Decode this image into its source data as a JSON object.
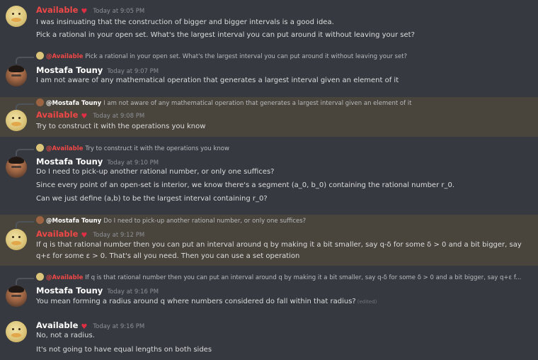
{
  "colors": {
    "background": "#36393f",
    "highlight": "#49443c",
    "available_name": "#f04747",
    "text": "#dcddde",
    "timestamp": "#8e9297"
  },
  "messages": [
    {
      "author": "Available",
      "timestamp": "Today at 9:05 PM",
      "lines": [
        "I was insinuating that the construction of bigger and bigger intervals is a good idea.",
        "Pick a rational in your open set. What's the largest interval you can put around it without leaving your set?"
      ]
    },
    {
      "reply": {
        "author": "@Available",
        "text": "Pick a rational in your open set. What's the largest interval you can put around it without leaving your set?"
      },
      "author": "Mostafa Touny",
      "timestamp": "Today at 9:07 PM",
      "lines": [
        "I am not aware of any mathematical operation that generates a largest interval given an element of it"
      ]
    },
    {
      "reply": {
        "author": "@Mostafa Touny",
        "text": "I am not aware of any mathematical operation that generates a largest interval given an element of it"
      },
      "author": "Available",
      "timestamp": "Today at 9:08 PM",
      "lines": [
        "Try to construct it with the operations you know"
      ]
    },
    {
      "reply": {
        "author": "@Available",
        "text": "Try to construct it with the operations you know"
      },
      "author": "Mostafa Touny",
      "timestamp": "Today at 9:10 PM",
      "lines": [
        "Do I need to pick-up another rational number, or only one suffices?",
        "Since every point of an open-set is interior, we know there's a segment (a_0, b_0) containing the rational number r_0.",
        "Can we just define (a,b) to be the largest interval containing r_0?"
      ]
    },
    {
      "reply": {
        "author": "@Mostafa Touny",
        "text": "Do I need to pick-up another rational number, or only one suffices?"
      },
      "author": "Available",
      "timestamp": "Today at 9:12 PM",
      "lines": [
        "If q is that rational number then you can put an interval around q by making it a bit smaller, say q-δ for some δ > 0 and a bit bigger, say",
        "q+ε for some ε > 0. That's all you need. Then you can use a set operation"
      ]
    },
    {
      "reply": {
        "author": "@Available",
        "text": "If q is that rational number then you can put an interval around q by making it a bit smaller, say q-δ for some δ > 0 and a bit bigger, say q+ε f..."
      },
      "author": "Mostafa Touny",
      "timestamp": "Today at 9:16 PM",
      "lines": [
        "You mean forming a radius around q where numbers considered do fall within that radius?"
      ],
      "edited": "(edited)"
    },
    {
      "author": "Available",
      "timestamp": "Today at 9:16 PM",
      "lines": [
        "No, not a radius.",
        "It's not going to have equal lengths on both sides"
      ]
    }
  ]
}
